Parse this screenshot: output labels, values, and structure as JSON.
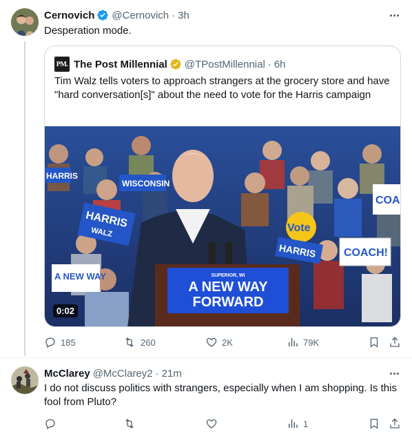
{
  "tweet": {
    "author_name": "Cernovich",
    "handle": "@Cernovich",
    "separator": "·",
    "time": "3h",
    "text": "Desperation mode.",
    "quoted": {
      "logo_text": "PM.",
      "author_name": "The Post Millennial",
      "handle": "@TPostMillennial",
      "separator": "·",
      "time": "6h",
      "text": "Tim Walz tells voters to approach strangers at the grocery store and have \"hard conversation[s]\" about the need to vote for the Harris campaign",
      "video_duration": "0:02",
      "podium_small": "SUPERIOR, WI",
      "podium_line1": "A NEW WAY",
      "podium_line2": "FORWARD",
      "signs": [
        "HARRIS",
        "WALZ",
        "WISCONSIN",
        "COACH!",
        "Vote",
        "HARRIS",
        "A NEW WAY",
        "COA",
        "HARRIS"
      ]
    },
    "actions": {
      "replies": "185",
      "retweets": "260",
      "likes": "2K",
      "views": "79K"
    }
  },
  "reply": {
    "author_name": "McClarey",
    "handle": "@McClarey2",
    "separator": "·",
    "time": "21m",
    "text": "I do not discuss politics with strangers, especially when I am shopping.  Is this fool from Pluto?",
    "actions": {
      "replies": "",
      "retweets": "",
      "likes": "",
      "views": "1"
    }
  },
  "colors": {
    "verified_blue": "#1d9bf0",
    "verified_gold": "#e2b719",
    "muted": "#536471",
    "border": "#cfd9de"
  }
}
